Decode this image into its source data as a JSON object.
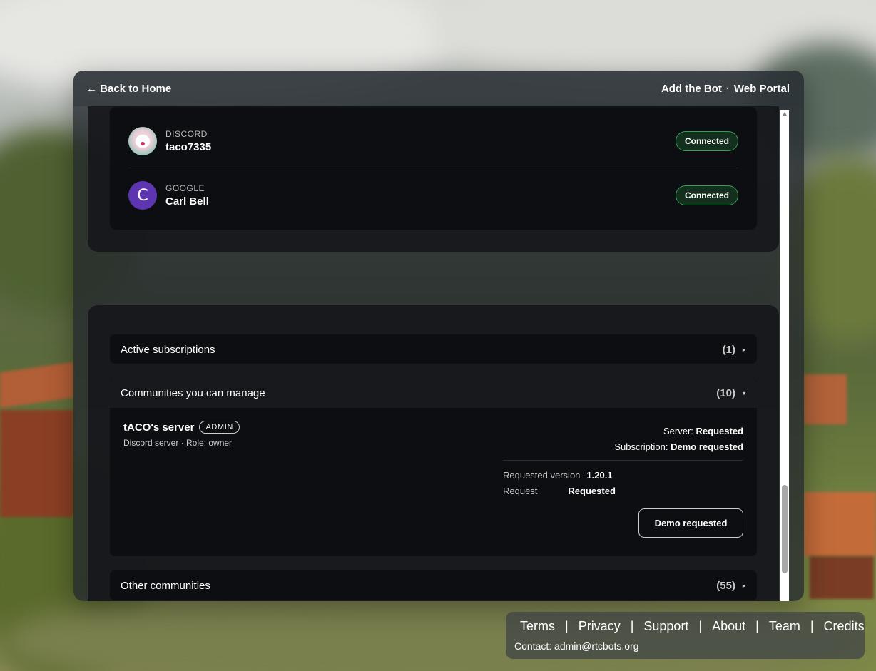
{
  "header": {
    "back_label": "← Back to Home",
    "right_title": "Add the Bot",
    "right_sep": "·",
    "right_subtitle": "Web Portal"
  },
  "accounts": [
    {
      "provider": "DISCORD",
      "name": "taco7335",
      "status": "Connected",
      "avatar": "discord-avatar"
    },
    {
      "provider": "GOOGLE",
      "name": "Carl Bell",
      "status": "Connected",
      "avatar_letter": "C"
    }
  ],
  "sections": {
    "active": {
      "label": "Active subscriptions",
      "count": "(1)",
      "caret": "▸"
    },
    "manage": {
      "label": "Communities you can manage",
      "count": "(10)",
      "caret": "▾"
    },
    "other": {
      "label": "Other communities",
      "count": "(55)",
      "caret": "▸"
    }
  },
  "community": {
    "name": "tACO's server",
    "badge": "ADMIN",
    "sub": "Discord server · Role: owner",
    "server_label": "Server:",
    "server_value": "Requested",
    "subscription_label": "Subscription:",
    "subscription_value": "Demo requested",
    "version_label": "Requested version",
    "version_value": "1.20.1",
    "request_label": "Request",
    "request_value": "Requested",
    "button_label": "Demo requested"
  },
  "footer": {
    "links": [
      "Terms",
      "Privacy",
      "Support",
      "About",
      "Team",
      "Credits"
    ],
    "separator": "|",
    "contact": "Contact: admin@rtcbots.org"
  }
}
